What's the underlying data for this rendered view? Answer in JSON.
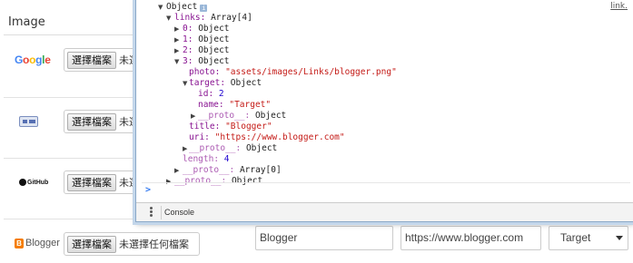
{
  "table": {
    "image_header": "Image",
    "rows": [
      {
        "logo": "Google",
        "choose_label": "選擇檔案",
        "no_file": "未選擇任何檔案"
      },
      {
        "logo": "facebook-like-icon",
        "choose_label": "選擇檔案",
        "no_file": "未選擇任何檔案"
      },
      {
        "logo": "GitHub",
        "choose_label": "選擇檔案",
        "no_file": "未選擇任何檔案"
      },
      {
        "logo": "Blogger",
        "choose_label": "選擇檔案",
        "no_file": "未選擇任何檔案"
      }
    ],
    "google_letters": [
      "G",
      "o",
      "o",
      "g",
      "l",
      "e"
    ],
    "blogger_title": "Blogger",
    "blogger_uri": "https://www.blogger.com",
    "blogger_target": "Target"
  },
  "devtools": {
    "link_ref": "link.",
    "lines": {
      "object_label": "Object",
      "links_key": "links:",
      "links_val": "Array[4]",
      "item0": "0:",
      "item1": "1:",
      "item2": "2:",
      "item3": "3:",
      "object": "Object",
      "photo_key": "photo:",
      "photo_val": "\"assets/images/Links/blogger.png\"",
      "target_key": "target:",
      "id_key": "id:",
      "id_val": "2",
      "name_key": "name:",
      "name_val": "\"Target\"",
      "proto_key": "__proto__:",
      "title_key": "title:",
      "title_val": "\"Blogger\"",
      "uri_key": "uri:",
      "uri_val": "\"https://www.blogger.com\"",
      "length_key": "length:",
      "length_val": "4",
      "array0": "Array[0]"
    },
    "prompt": ">",
    "drawer_tab": "Console"
  }
}
